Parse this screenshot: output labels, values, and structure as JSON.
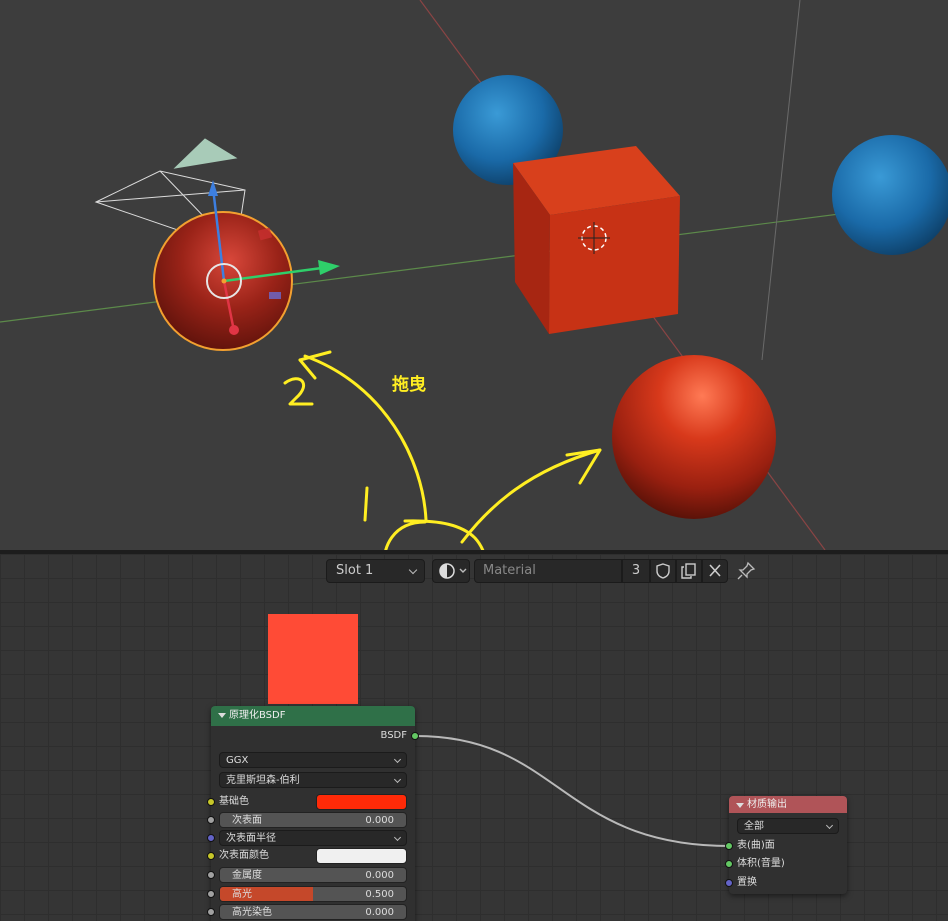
{
  "viewport": {
    "annotation_drag": "拖曳",
    "annotation_one": "1",
    "annotation_two": "2"
  },
  "header": {
    "slot": "Slot 1",
    "material_name": "Material",
    "user_count": "3"
  },
  "colors": {
    "base_color": "#ff2a08",
    "subsurface_color": "#f0f0f0",
    "preview": "#ff4b36",
    "bsdf_header": "#2f7048",
    "output_header": "#b05458",
    "annotation": "#ffee22",
    "socket_shader": "#63c763",
    "socket_color": "#c7c729",
    "socket_float": "#a1a1a1",
    "socket_vector": "#6363c7"
  },
  "bsdf_node": {
    "title": "原理化BSDF",
    "output": "BSDF",
    "distribution": "GGX",
    "subsurface_method": "克里斯坦森-伯利",
    "base_color_label": "基础色",
    "subsurface_label": "次表面",
    "subsurface_value": "0.000",
    "subsurface_radius_label": "次表面半径",
    "subsurface_color_label": "次表面颜色",
    "metallic_label": "金属度",
    "metallic_value": "0.000",
    "specular_label": "高光",
    "specular_value": "0.500",
    "specular_fraction": 0.5,
    "specular_tint_label": "高光染色",
    "specular_tint_value": "0.000"
  },
  "output_node": {
    "title": "材质输出",
    "target": "全部",
    "surface": "表(曲)面",
    "volume": "体积(音量)",
    "displacement": "置换"
  }
}
